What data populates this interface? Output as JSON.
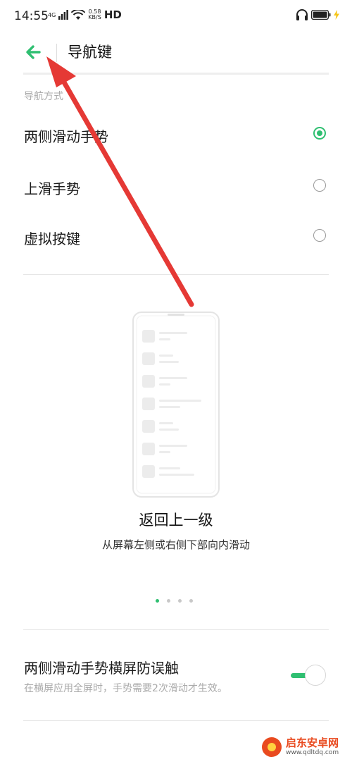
{
  "status_bar": {
    "time": "14:55",
    "network": "4G",
    "speed_value": "0.58",
    "speed_unit": "KB/S",
    "hd": "HD",
    "icons": [
      "signal-icon",
      "wifi-icon",
      "headphones-icon",
      "battery-icon",
      "charging-icon"
    ]
  },
  "app_bar": {
    "title": "导航键",
    "back_icon": "arrow-left-icon"
  },
  "navigation_mode": {
    "caption": "导航方式",
    "options": [
      {
        "label": "两侧滑动手势",
        "selected": true
      },
      {
        "label": "上滑手势",
        "selected": false
      },
      {
        "label": "虚拟按键",
        "selected": false
      }
    ]
  },
  "illustration": {
    "title": "返回上一级",
    "subtitle": "从屏幕左侧或右侧下部向内滑动",
    "pages": 4,
    "active_page": 1
  },
  "gesture_protection": {
    "title": "两侧滑动手势横屏防误触",
    "subtitle": "在横屏应用全屏时，手势需要2次滑动才生效。",
    "enabled": true
  },
  "watermark": {
    "name": "启东安卓网",
    "url": "www.qdltdq.com"
  },
  "colors": {
    "accent": "#2fbf71",
    "annotation_arrow": "#e53935"
  }
}
